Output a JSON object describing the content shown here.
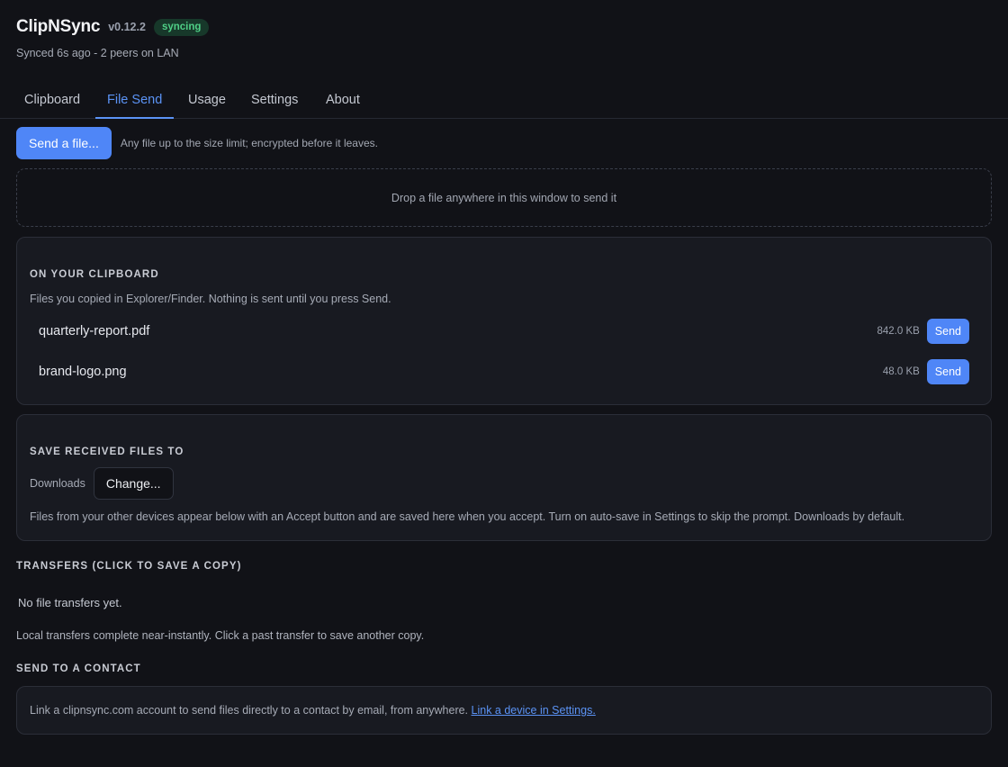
{
  "header": {
    "app_name": "ClipNSync",
    "version": "v0.12.2",
    "status": "syncing",
    "subtitle": "Synced 6s ago - 2 peers on LAN"
  },
  "tabs": [
    {
      "label": "Clipboard",
      "active": false
    },
    {
      "label": "File Send",
      "active": true
    },
    {
      "label": "Usage",
      "active": false
    },
    {
      "label": "Settings",
      "active": false
    },
    {
      "label": "About",
      "active": false
    }
  ],
  "send": {
    "button_label": "Send a file...",
    "hint": "Any file up to the size limit; encrypted before it leaves."
  },
  "dropzone": {
    "text": "Drop a file anywhere in this window to send it"
  },
  "clipboard_section": {
    "heading": "ON YOUR CLIPBOARD",
    "description": "Files you copied in Explorer/Finder. Nothing is sent until you press Send.",
    "files": [
      {
        "name": "quarterly-report.pdf",
        "size": "842.0 KB",
        "action": "Send"
      },
      {
        "name": "brand-logo.png",
        "size": "48.0 KB",
        "action": "Send"
      }
    ]
  },
  "save_section": {
    "heading": "SAVE RECEIVED FILES TO",
    "folder": "Downloads",
    "change_label": "Change...",
    "description": "Files from your other devices appear below with an Accept button and are saved here when you accept. Turn on auto-save in Settings to skip the prompt. Downloads by default."
  },
  "transfers_section": {
    "heading": "TRANSFERS (CLICK TO SAVE A COPY)",
    "empty": "No file transfers yet.",
    "note": "Local transfers complete near-instantly. Click a past transfer to save another copy."
  },
  "contact_section": {
    "heading": "SEND TO A CONTACT",
    "text": "Link a clipnsync.com account to send files directly to a contact by email, from anywhere. ",
    "link": "Link a device in Settings."
  },
  "colors": {
    "background": "#111217",
    "card": "#181a21",
    "accent": "#4f86f7",
    "status_green": "#4fcf86"
  }
}
